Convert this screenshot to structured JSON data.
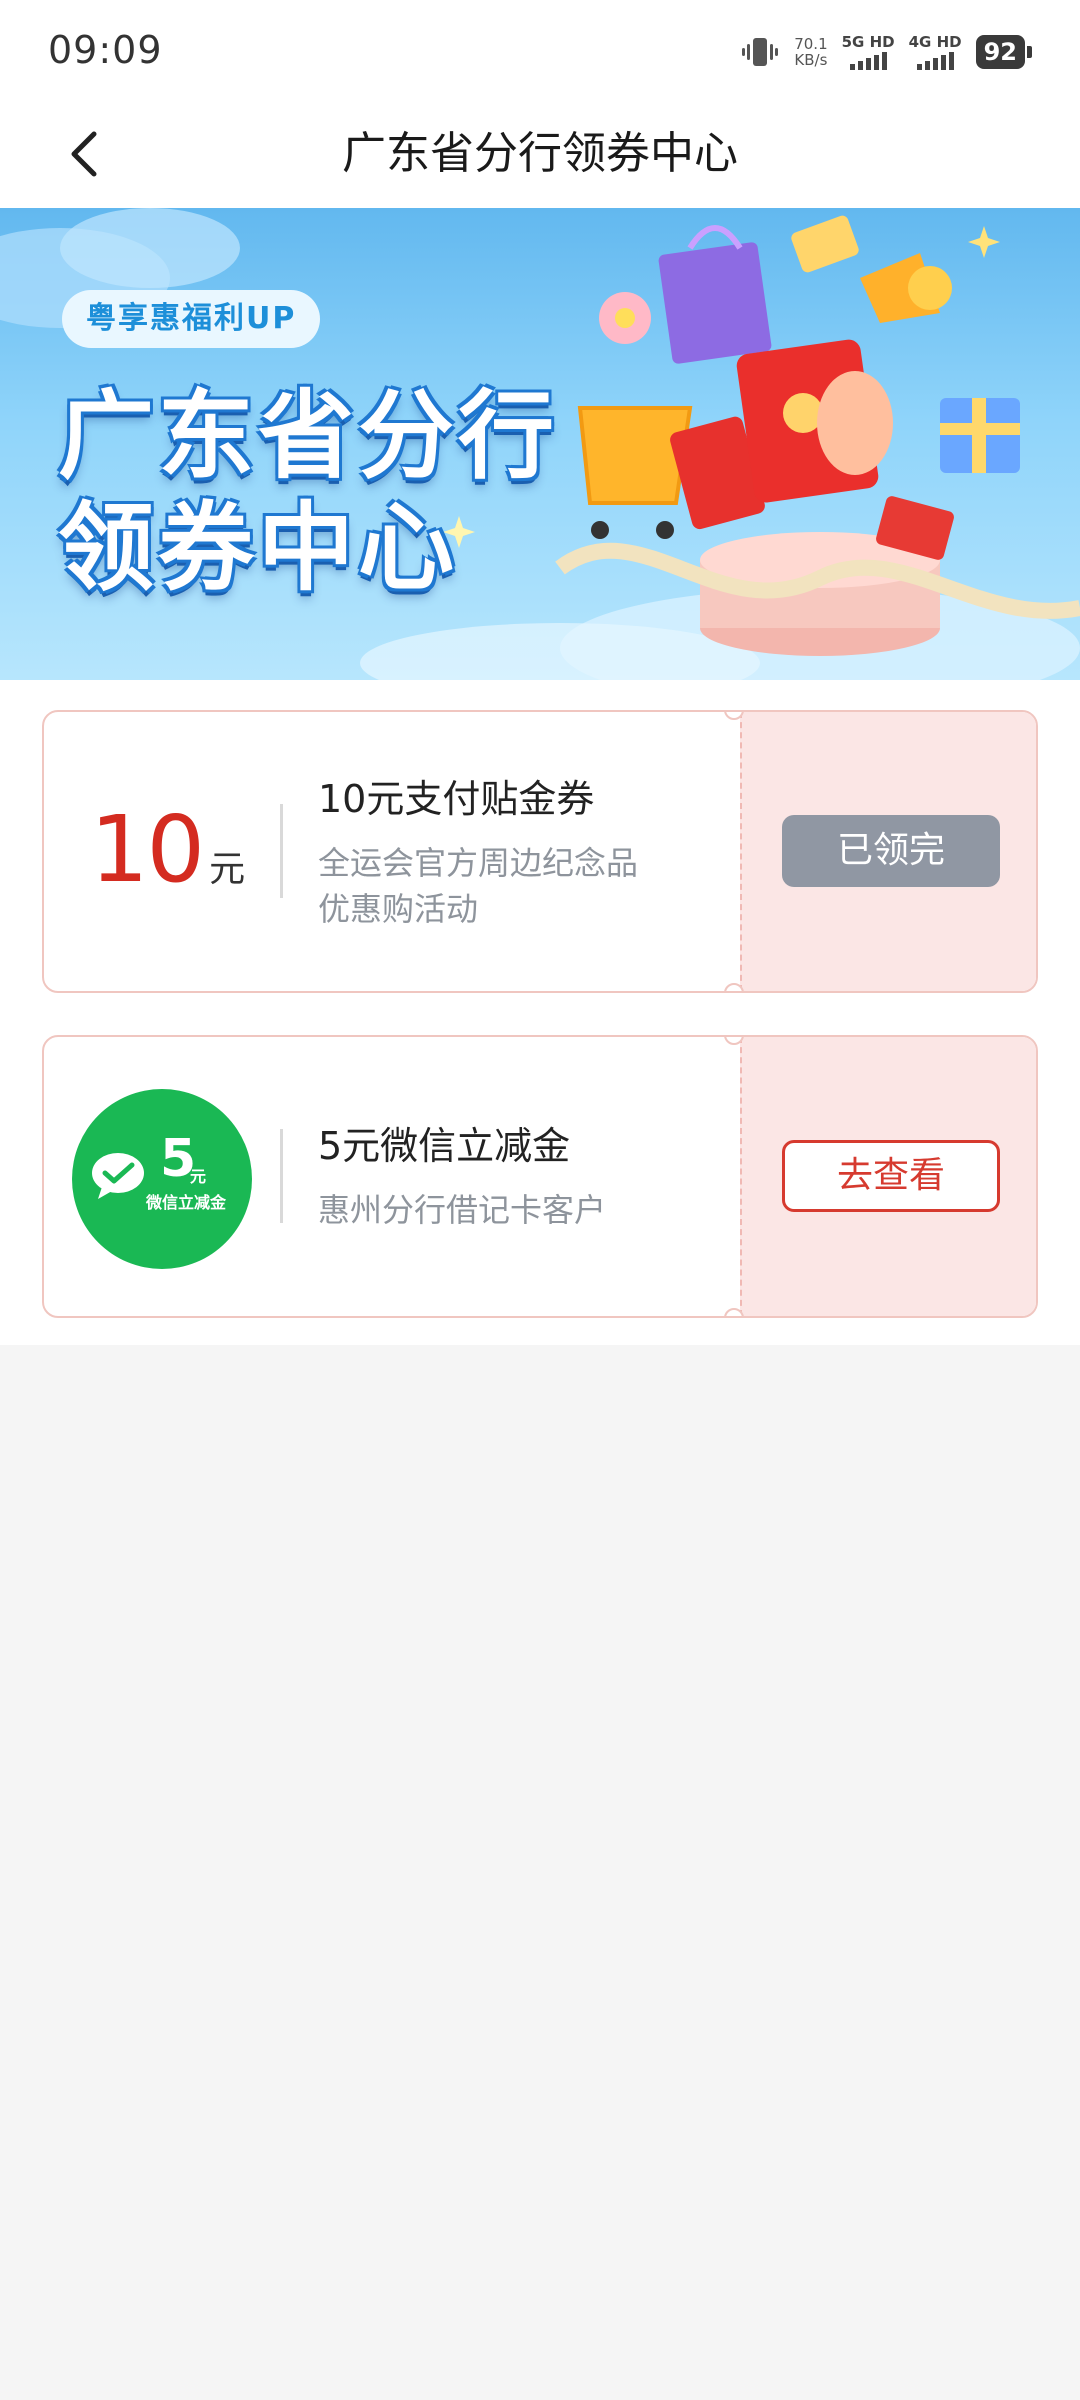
{
  "status_bar": {
    "time": "09:09",
    "net_speed_value": "70.1",
    "net_speed_unit": "KB/s",
    "sim1_label": "5G HD",
    "sim2_label": "4G HD",
    "battery": "92"
  },
  "header": {
    "title": "广东省分行领券中心",
    "back_icon": "chevron-left-icon"
  },
  "banner": {
    "pill_text": "粤享惠福利UP",
    "title_line1": "广东省分行",
    "title_line2": "领券中心"
  },
  "coupons": [
    {
      "amount": "10",
      "unit": "元",
      "title": "10元支付贴金券",
      "desc_line1": "全运会官方周边纪念品",
      "desc_line2": "优惠购活动",
      "button": "已领完",
      "status": "claimed"
    },
    {
      "badge_amount": "5",
      "badge_unit": "元",
      "badge_label": "微信立减金",
      "title": "5元微信立减金",
      "desc_line1": "惠州分行借记卡客户",
      "button": "去查看",
      "status": "available",
      "brand_color": "#1ab854"
    }
  ],
  "colors": {
    "accent_red": "#d42b20",
    "claimed_gray": "#9097a3",
    "coupon_pink": "#fbe6e5",
    "banner_blue": "#62b8ef"
  }
}
